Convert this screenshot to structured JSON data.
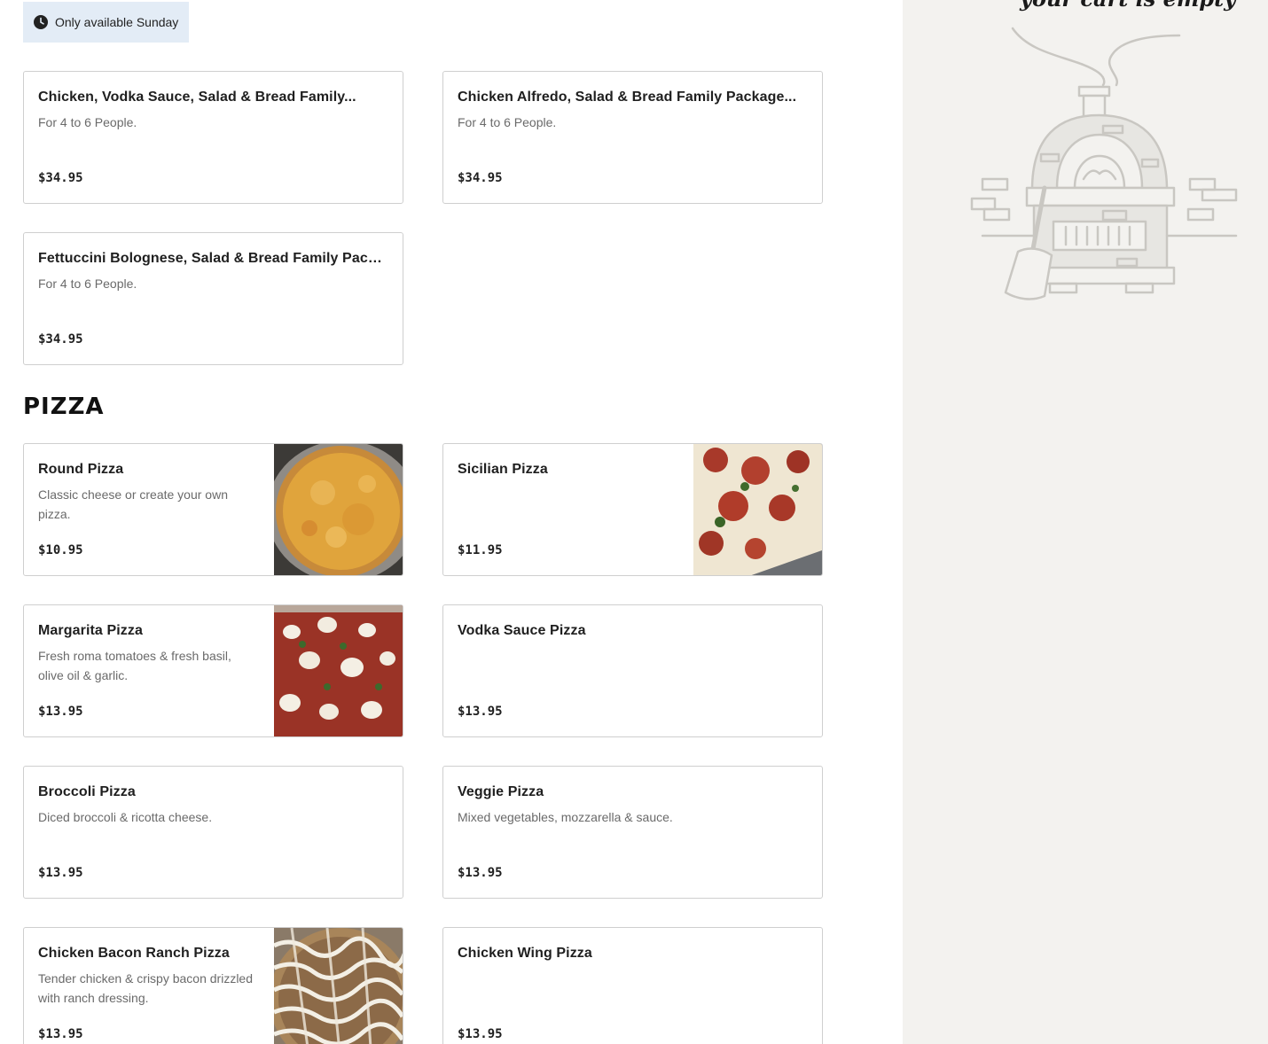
{
  "availability": {
    "text": "Only available Sunday"
  },
  "family_packages": [
    {
      "name": "Chicken, Vodka Sauce, Salad & Bread Family...",
      "desc": "For 4 to 6 People.",
      "price": "$34.95"
    },
    {
      "name": "Chicken Alfredo, Salad & Bread Family Package...",
      "desc": "For 4 to 6 People.",
      "price": "$34.95"
    },
    {
      "name": "Fettuccini Bolognese, Salad & Bread Family Packag...",
      "desc": "For 4 to 6 People.",
      "price": "$34.95"
    }
  ],
  "pizza_section": {
    "title": "PIZZA",
    "items": [
      {
        "name": "Round Pizza",
        "desc": "Classic cheese or create your own pizza.",
        "price": "$10.95"
      },
      {
        "name": "Sicilian Pizza",
        "desc": "",
        "price": "$11.95"
      },
      {
        "name": "Margarita Pizza",
        "desc": "Fresh roma tomatoes & fresh basil, olive oil & garlic.",
        "price": "$13.95"
      },
      {
        "name": "Vodka Sauce Pizza",
        "desc": "",
        "price": "$13.95"
      },
      {
        "name": "Broccoli Pizza",
        "desc": "Diced broccoli & ricotta cheese.",
        "price": "$13.95"
      },
      {
        "name": "Veggie Pizza",
        "desc": "Mixed vegetables, mozzarella & sauce.",
        "price": "$13.95"
      },
      {
        "name": "Chicken Bacon Ranch Pizza",
        "desc": "Tender chicken & crispy bacon drizzled with ranch dressing.",
        "price": "$13.95"
      },
      {
        "name": "Chicken Wing Pizza",
        "desc": "",
        "price": "$13.95"
      }
    ]
  },
  "cart": {
    "title": "your cart is empty"
  },
  "icons": {
    "availability": "clock-icon",
    "empty_cart": "pizza-oven-illustration"
  }
}
